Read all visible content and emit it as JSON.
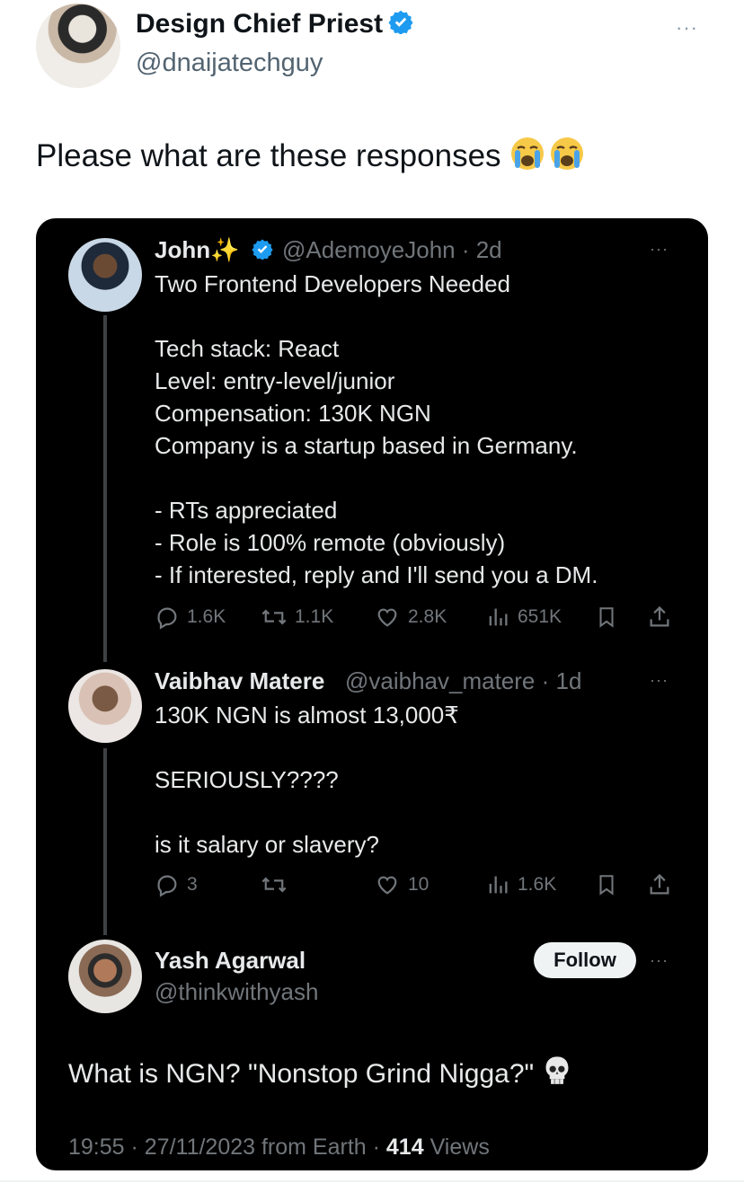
{
  "outer_tweet": {
    "display_name": "Design Chief Priest",
    "handle": "@dnaijatechguy",
    "text": "Please what are these responses",
    "emoji": "😭 😭",
    "more": "···"
  },
  "quoted_thread": {
    "tweets": [
      {
        "name": "John",
        "name_emoji": "✨",
        "handle_time": "@AdemoyeJohn · 2d",
        "lines": [
          "Two Frontend Developers Needed",
          "",
          "Tech stack: React",
          "Level: entry-level/junior",
          "Compensation: 130K NGN",
          "Company is a startup based in Germany.",
          "",
          "- RTs appreciated",
          "- Role is 100% remote (obviously)",
          "- If interested, reply and I'll send you a DM."
        ],
        "replies": "1.6K",
        "retweets": "1.1K",
        "likes": "2.8K",
        "views": "651K",
        "more": "···"
      },
      {
        "name": "Vaibhav Matere",
        "handle_time": "@vaibhav_matere · 1d",
        "lines": [
          "130K NGN is almost 13,000₹",
          "",
          "SERIOUSLY????",
          "",
          "is it salary or slavery?"
        ],
        "replies": "3",
        "retweets": "",
        "likes": "10",
        "views": "1.6K",
        "more": "···"
      }
    ],
    "main_reply": {
      "name": "Yash Agarwal",
      "handle": "@thinkwithyash",
      "follow_label": "Follow",
      "text": "What is NGN? \"Nonstop Grind Nigga?\"",
      "emoji": "💀",
      "time": "19:55 · 27/11/2023 from Earth · ",
      "views_count": "414",
      "views_label": "Views",
      "more": "···"
    }
  },
  "colors": {
    "card_bg": "#000000",
    "verified_blue": "#1d9bf0",
    "muted": "#71767b",
    "follow_bg": "#eff3f4"
  },
  "icons": [
    "verified-badge-icon",
    "more-icon",
    "reply-icon",
    "retweet-icon",
    "like-icon",
    "views-icon",
    "bookmark-icon",
    "share-icon",
    "skull-emoji",
    "loudly-crying-emoji"
  ]
}
